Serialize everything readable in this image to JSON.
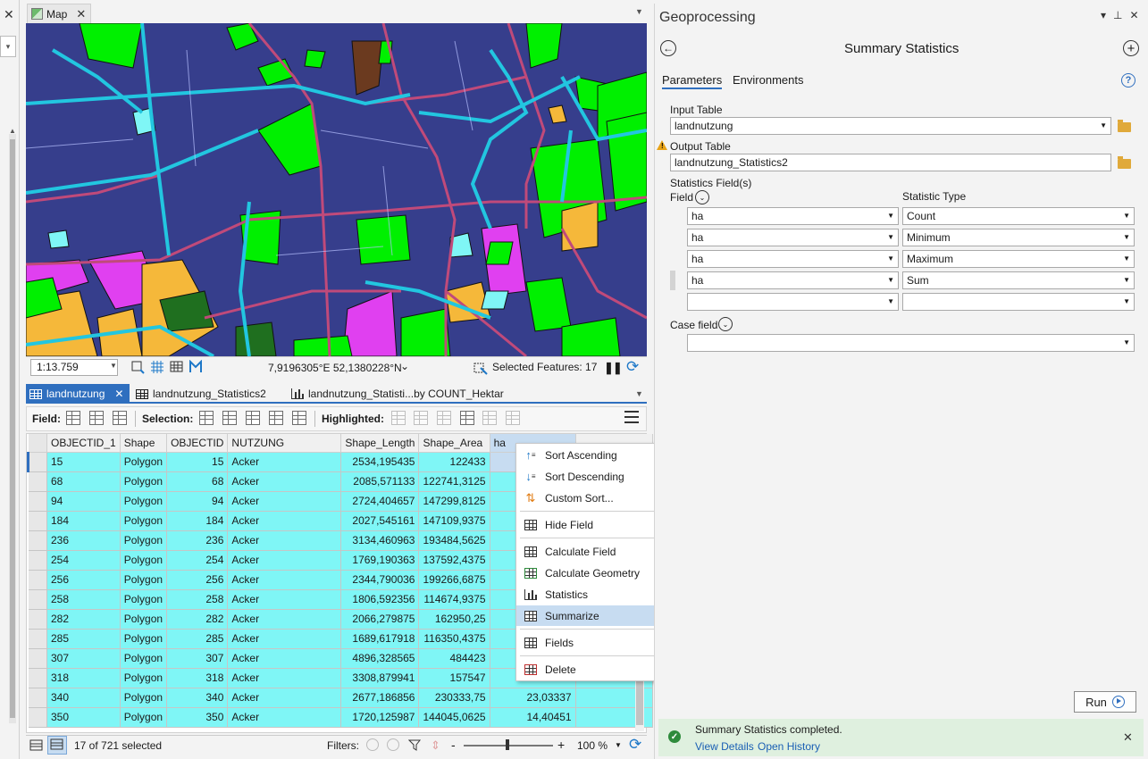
{
  "map_view": {
    "tab_label": "Map",
    "scale": "1:13.759",
    "coordinates": "7,9196305°E 52,1380228°N",
    "selected_features": "Selected Features: 17"
  },
  "table_view": {
    "tabs": [
      {
        "label": "landnutzung"
      },
      {
        "label": "landnutzung_Statistics2"
      },
      {
        "label": "landnutzung_Statisti...by COUNT_Hektar"
      }
    ],
    "toolbar": {
      "field_label": "Field:",
      "selection_label": "Selection:",
      "highlighted_label": "Highlighted:"
    },
    "columns": [
      "OBJECTID_1",
      "Shape",
      "OBJECTID",
      "NUTZUNG",
      "Shape_Length",
      "Shape_Area",
      "ha"
    ],
    "rows": [
      {
        "objectid_1": "15",
        "shape": "Polygon",
        "objectid": "15",
        "nutzung": "Acker",
        "length": "2534,195435",
        "area": "122433",
        "ha": ""
      },
      {
        "objectid_1": "68",
        "shape": "Polygon",
        "objectid": "68",
        "nutzung": "Acker",
        "length": "2085,571133",
        "area": "122741,3125",
        "ha": "1"
      },
      {
        "objectid_1": "94",
        "shape": "Polygon",
        "objectid": "94",
        "nutzung": "Acker",
        "length": "2724,404657",
        "area": "147299,8125",
        "ha": "1"
      },
      {
        "objectid_1": "184",
        "shape": "Polygon",
        "objectid": "184",
        "nutzung": "Acker",
        "length": "2027,545161",
        "area": "147109,9375",
        "ha": "1"
      },
      {
        "objectid_1": "236",
        "shape": "Polygon",
        "objectid": "236",
        "nutzung": "Acker",
        "length": "3134,460963",
        "area": "193484,5625",
        "ha": "1"
      },
      {
        "objectid_1": "254",
        "shape": "Polygon",
        "objectid": "254",
        "nutzung": "Acker",
        "length": "1769,190363",
        "area": "137592,4375",
        "ha": "1"
      },
      {
        "objectid_1": "256",
        "shape": "Polygon",
        "objectid": "256",
        "nutzung": "Acker",
        "length": "2344,790036",
        "area": "199266,6875",
        "ha": "1"
      },
      {
        "objectid_1": "258",
        "shape": "Polygon",
        "objectid": "258",
        "nutzung": "Acker",
        "length": "1806,592356",
        "area": "114674,9375",
        "ha": "1"
      },
      {
        "objectid_1": "282",
        "shape": "Polygon",
        "objectid": "282",
        "nutzung": "Acker",
        "length": "2066,279875",
        "area": "162950,25",
        "ha": "1"
      },
      {
        "objectid_1": "285",
        "shape": "Polygon",
        "objectid": "285",
        "nutzung": "Acker",
        "length": "1689,617918",
        "area": "116350,4375",
        "ha": "1"
      },
      {
        "objectid_1": "307",
        "shape": "Polygon",
        "objectid": "307",
        "nutzung": "Acker",
        "length": "4896,328565",
        "area": "484423",
        "ha": ""
      },
      {
        "objectid_1": "318",
        "shape": "Polygon",
        "objectid": "318",
        "nutzung": "Acker",
        "length": "3308,879941",
        "area": "157547",
        "ha": ""
      },
      {
        "objectid_1": "340",
        "shape": "Polygon",
        "objectid": "340",
        "nutzung": "Acker",
        "length": "2677,186856",
        "area": "230333,75",
        "ha": "23,03337"
      },
      {
        "objectid_1": "350",
        "shape": "Polygon",
        "objectid": "350",
        "nutzung": "Acker",
        "length": "1720,125987",
        "area": "144045,0625",
        "ha": "14,40451"
      }
    ],
    "footer": {
      "selected_count": "17 of 721 selected",
      "filters_label": "Filters:",
      "zoom_minus": "-",
      "zoom_plus": "+",
      "zoom": "100 %"
    }
  },
  "context_menu": {
    "items": [
      {
        "label": "Sort Ascending",
        "icon": "sort-ascending-icon"
      },
      {
        "label": "Sort Descending",
        "icon": "sort-descending-icon"
      },
      {
        "label": "Custom Sort...",
        "icon": "custom-sort-icon"
      },
      {
        "label": "Hide Field",
        "icon": "hide-field-icon"
      },
      {
        "label": "Calculate Field",
        "icon": "calculate-field-icon"
      },
      {
        "label": "Calculate Geometry",
        "icon": "calculate-geometry-icon"
      },
      {
        "label": "Statistics",
        "icon": "statistics-icon"
      },
      {
        "label": "Summarize",
        "icon": "summarize-icon"
      },
      {
        "label": "Fields",
        "icon": "fields-icon"
      },
      {
        "label": "Delete",
        "icon": "delete-icon"
      }
    ],
    "active": "Summarize"
  },
  "geoprocessing": {
    "pane_title": "Geoprocessing",
    "tool_title": "Summary Statistics",
    "tabs": {
      "parameters": "Parameters",
      "environments": "Environments"
    },
    "input_table_label": "Input Table",
    "input_table_value": "landnutzung",
    "output_table_label": "Output Table",
    "output_table_value": "landnutzung_Statistics2",
    "statistics_fields_label": "Statistics Field(s)",
    "field_header": "Field",
    "statistic_type_header": "Statistic Type",
    "stat_rows": [
      {
        "field": "ha",
        "type": "Count"
      },
      {
        "field": "ha",
        "type": "Minimum"
      },
      {
        "field": "ha",
        "type": "Maximum"
      },
      {
        "field": "ha",
        "type": "Sum"
      },
      {
        "field": "",
        "type": ""
      }
    ],
    "case_field_label": "Case field",
    "case_field_value": "",
    "run_label": "Run",
    "status": {
      "message": "Summary Statistics completed.",
      "view_details": "View Details",
      "open_history": "Open History"
    }
  },
  "colors": {
    "accent": "#2f6fbf",
    "selected_row": "#7ff6f6",
    "map_background": "#363e8c",
    "parcel_green": "#00f000",
    "parcel_magenta": "#e040f0",
    "parcel_orange": "#f5b83a",
    "road_pink": "#c04a7a",
    "water_cyan": "#22c6e0"
  }
}
